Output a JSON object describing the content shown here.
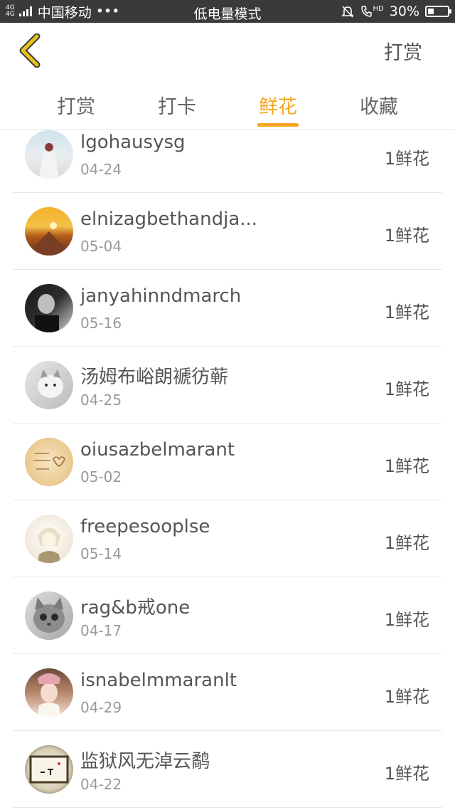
{
  "status_bar": {
    "network_top": "4G",
    "network_bottom": "4G",
    "carrier": "中国移动",
    "dots": "•••",
    "mode": "低电量模式",
    "hd": "HD",
    "battery": "30%",
    "battery_level": 0.3
  },
  "header": {
    "back_icon": "chevron-left-icon",
    "action_label": "打赏"
  },
  "tabs": [
    {
      "label": "打赏",
      "active": false
    },
    {
      "label": "打卡",
      "active": false
    },
    {
      "label": "鲜花",
      "active": true
    },
    {
      "label": "收藏",
      "active": false
    }
  ],
  "colors": {
    "accent": "#f5a623",
    "back_icon": "#d4a300"
  },
  "list": [
    {
      "name": "lgohausysg",
      "date": "04-24",
      "amount": "1鲜花"
    },
    {
      "name": "elnizagbethandja...",
      "date": "05-04",
      "amount": "1鲜花"
    },
    {
      "name": "janyahinndmarch",
      "date": "05-16",
      "amount": "1鲜花"
    },
    {
      "name": "汤姆布峪朗褫彷蕲",
      "date": "04-25",
      "amount": "1鲜花"
    },
    {
      "name": "oiusazbelmarant",
      "date": "05-02",
      "amount": "1鲜花"
    },
    {
      "name": "freepesooplse",
      "date": "05-14",
      "amount": "1鲜花"
    },
    {
      "name": "rag&b戒one",
      "date": "04-17",
      "amount": "1鲜花"
    },
    {
      "name": "isnabelmmaranlt",
      "date": "04-29",
      "amount": "1鲜花"
    },
    {
      "name": "监狱风无淖云鹬",
      "date": "04-22",
      "amount": "1鲜花"
    }
  ]
}
